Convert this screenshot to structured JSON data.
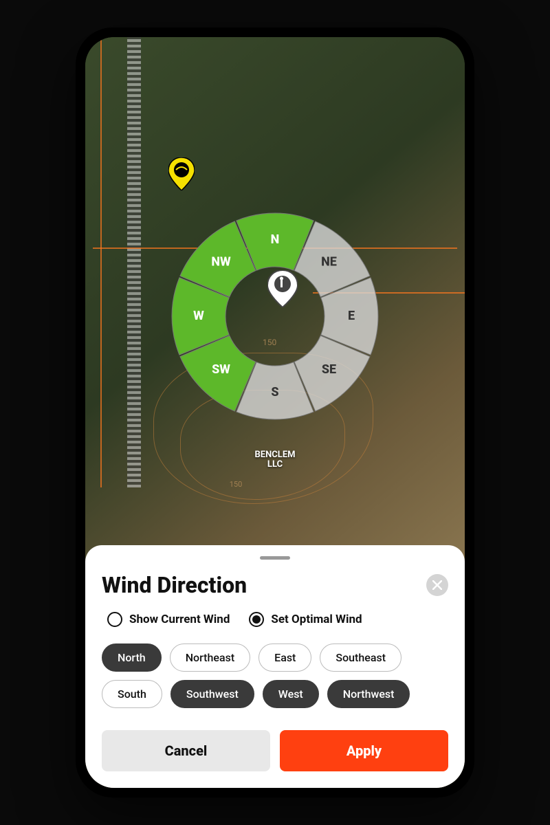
{
  "compass": {
    "segments": [
      {
        "dir": "N",
        "label": "N",
        "selected": true,
        "angle": -90
      },
      {
        "dir": "NE",
        "label": "NE",
        "selected": false,
        "angle": -45
      },
      {
        "dir": "E",
        "label": "E",
        "selected": false,
        "angle": 0
      },
      {
        "dir": "SE",
        "label": "SE",
        "selected": false,
        "angle": 45
      },
      {
        "dir": "S",
        "label": "S",
        "selected": false,
        "angle": 90
      },
      {
        "dir": "SW",
        "label": "SW",
        "selected": true,
        "angle": 135
      },
      {
        "dir": "W",
        "label": "W",
        "selected": true,
        "angle": 180
      },
      {
        "dir": "NW",
        "label": "NW",
        "selected": true,
        "angle": 225
      }
    ],
    "center_elev": "150",
    "colors": {
      "selected": "#5db82a",
      "unselected": "#d8d8d8cc"
    }
  },
  "map": {
    "parcel_label_line1": "BENCLEM",
    "parcel_label_line2": "LLC",
    "contour_elev": "150"
  },
  "sheet": {
    "title": "Wind Direction",
    "radios": [
      {
        "label": "Show Current Wind",
        "selected": false
      },
      {
        "label": "Set Optimal Wind",
        "selected": true
      }
    ],
    "chips": [
      {
        "label": "North",
        "selected": true
      },
      {
        "label": "Northeast",
        "selected": false
      },
      {
        "label": "East",
        "selected": false
      },
      {
        "label": "Southeast",
        "selected": false
      },
      {
        "label": "South",
        "selected": false
      },
      {
        "label": "Southwest",
        "selected": true
      },
      {
        "label": "West",
        "selected": true
      },
      {
        "label": "Northwest",
        "selected": true
      }
    ],
    "cancel_label": "Cancel",
    "apply_label": "Apply"
  }
}
